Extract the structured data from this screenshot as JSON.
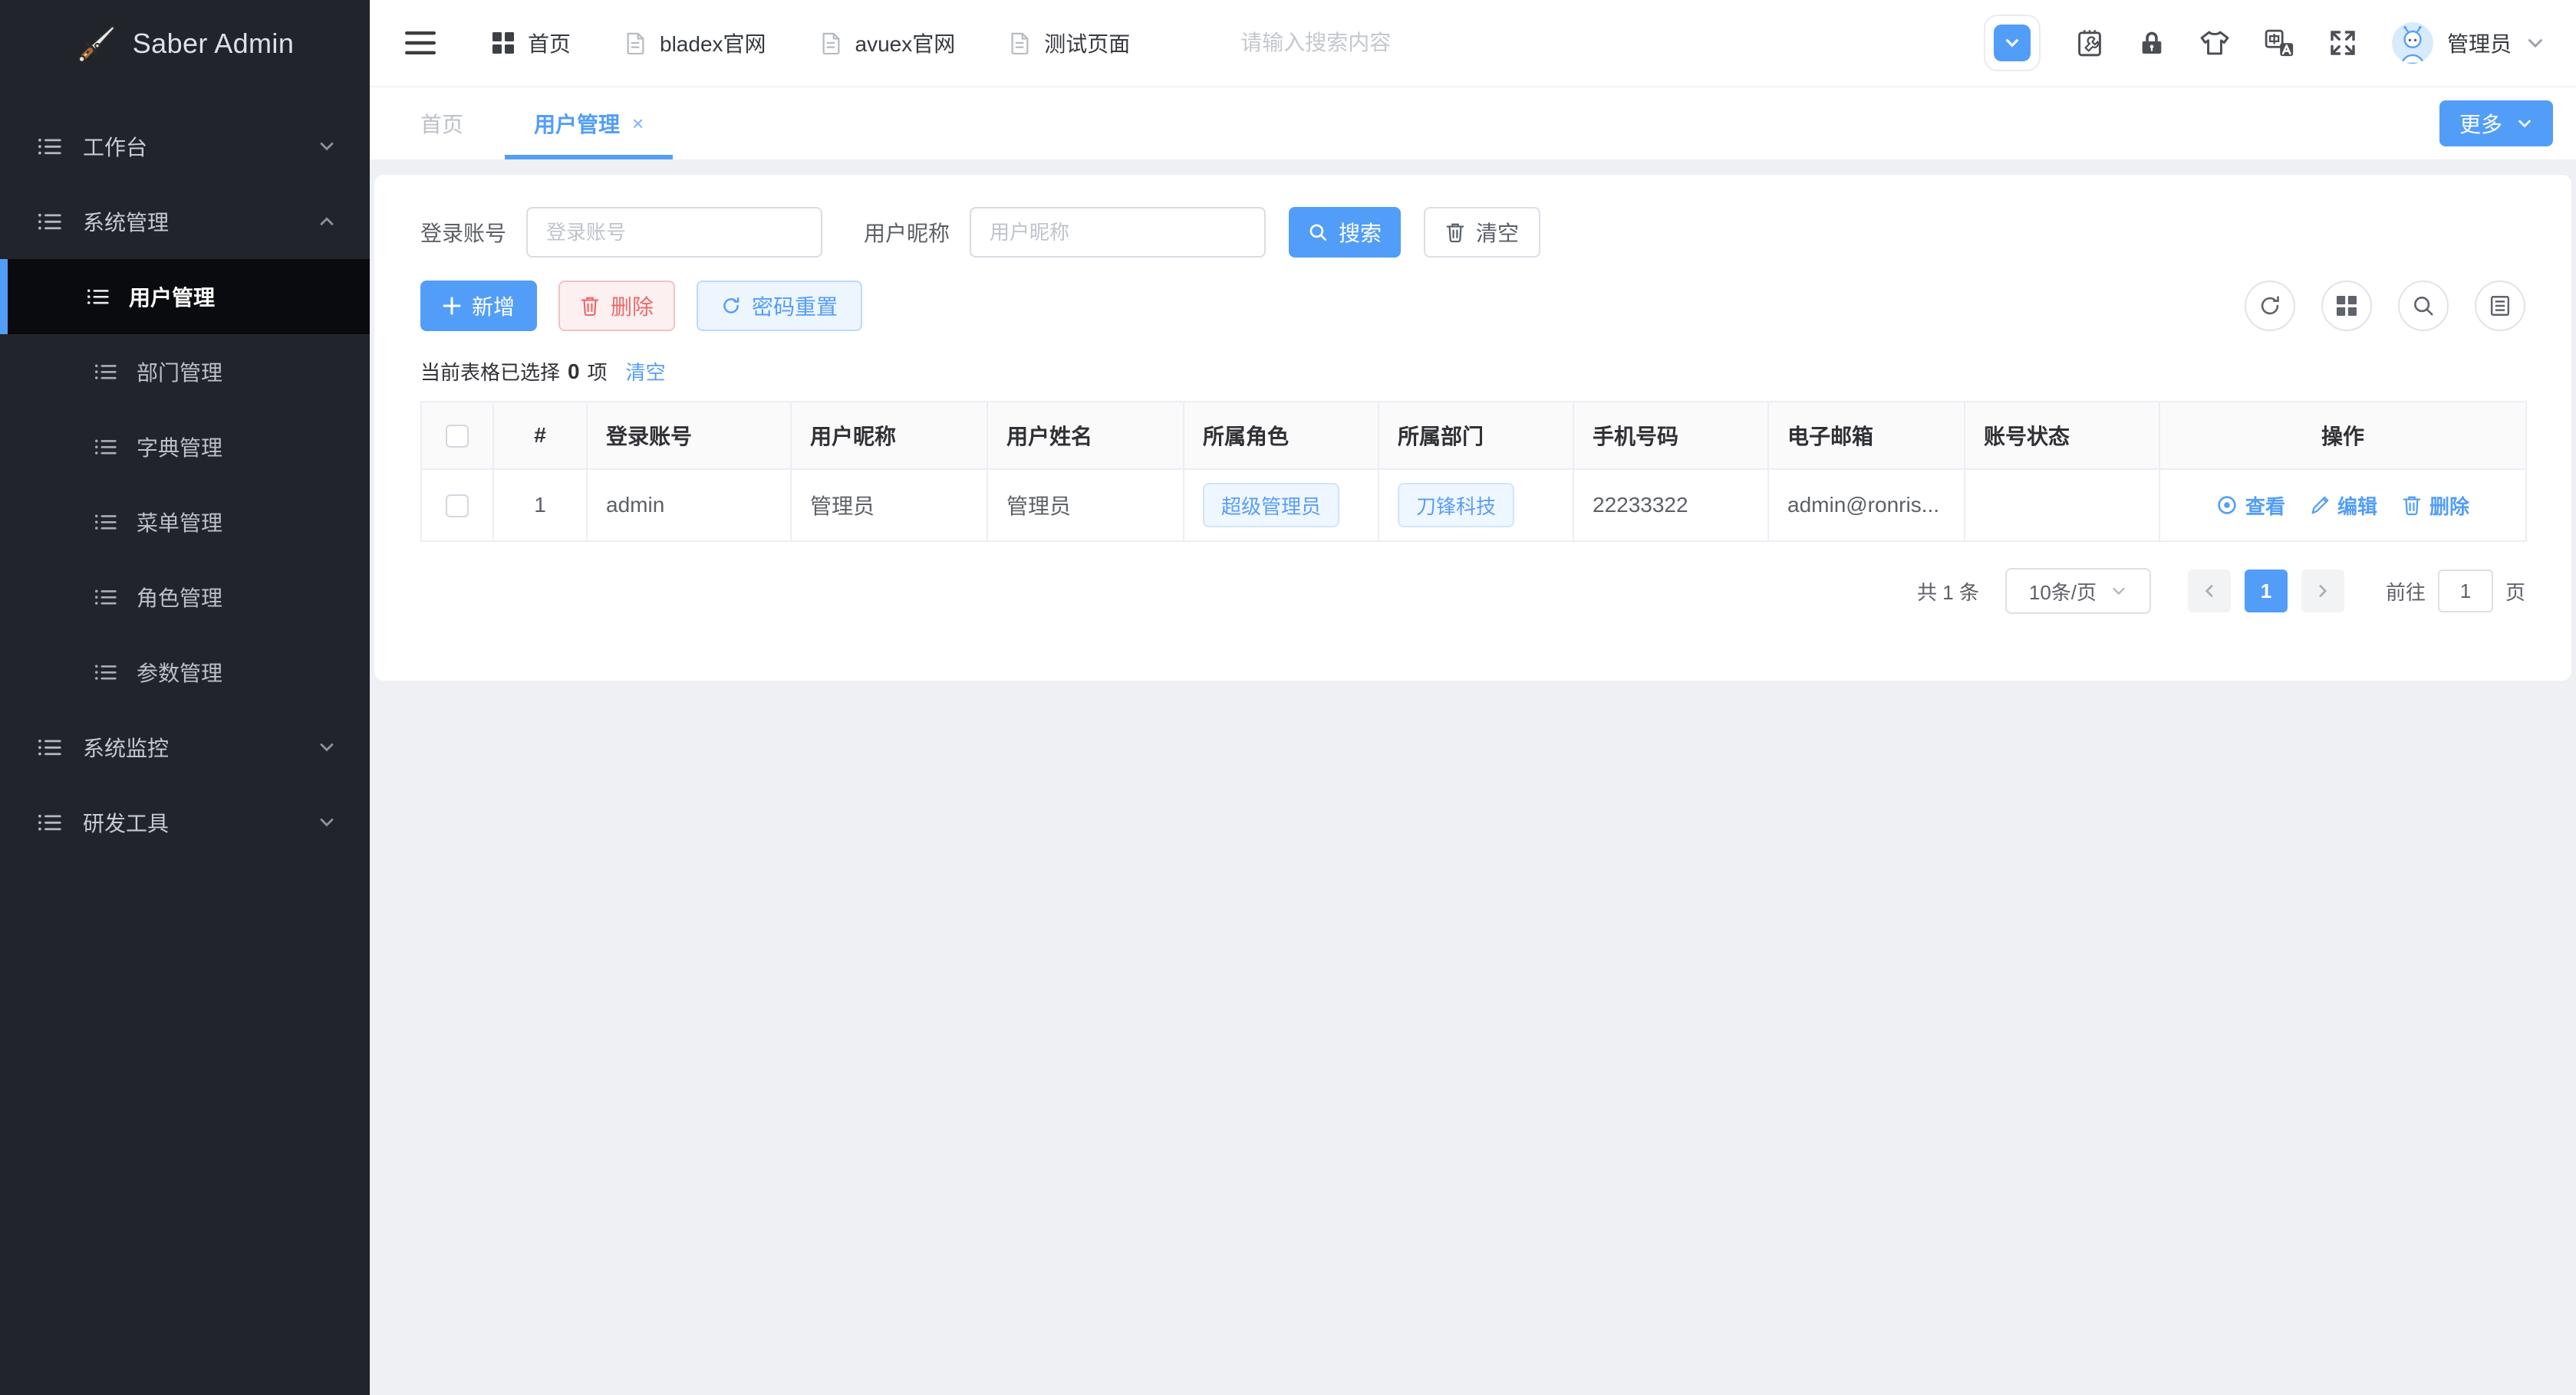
{
  "colors": {
    "accent": "#529df8",
    "danger": "#ec6a6a",
    "sidebar_bg": "#22242b",
    "sidebar_active_bg": "#0a0b0e",
    "page_bg": "#eef0f4",
    "tag_bg": "#eef6ff"
  },
  "logo": {
    "title": "Saber Admin",
    "icon": "dagger-icon"
  },
  "sidebar": {
    "groups": [
      {
        "label": "工作台",
        "state": "collapsed"
      },
      {
        "label": "系统管理",
        "state": "expanded",
        "children": [
          {
            "label": "用户管理",
            "active": true
          },
          {
            "label": "部门管理",
            "active": false
          },
          {
            "label": "字典管理",
            "active": false
          },
          {
            "label": "菜单管理",
            "active": false
          },
          {
            "label": "角色管理",
            "active": false
          },
          {
            "label": "参数管理",
            "active": false
          }
        ]
      },
      {
        "label": "系统监控",
        "state": "collapsed"
      },
      {
        "label": "研发工具",
        "state": "collapsed"
      }
    ]
  },
  "topbar": {
    "menu_items": [
      {
        "label": "首页",
        "icon": "grid-icon"
      },
      {
        "label": "bladex官网",
        "icon": "document-icon"
      },
      {
        "label": "avuex官网",
        "icon": "document-icon"
      },
      {
        "label": "测试页面",
        "icon": "document-icon"
      }
    ],
    "search_placeholder": "请输入搜索内容",
    "right_icons": [
      "top-menu-toggle",
      "debug-icon",
      "lock-icon",
      "theme-icon",
      "language-icon",
      "fullscreen-icon"
    ],
    "user": {
      "name": "管理员"
    }
  },
  "tabs": {
    "items": [
      {
        "label": "首页",
        "active": false
      },
      {
        "label": "用户管理",
        "active": true,
        "close": "×"
      }
    ],
    "more_label": "更多"
  },
  "filters": {
    "fields": [
      {
        "label": "登录账号",
        "placeholder": "登录账号",
        "value": ""
      },
      {
        "label": "用户昵称",
        "placeholder": "用户昵称",
        "value": ""
      }
    ],
    "search_label": "搜索",
    "clear_label": "清空"
  },
  "toolbar": {
    "add_label": "新增",
    "delete_label": "删除",
    "reset_pwd_label": "密码重置",
    "circle_icons": [
      "refresh-icon",
      "grid-icon",
      "search-icon",
      "list-icon"
    ]
  },
  "selection": {
    "prefix": "当前表格已选择",
    "count": "0",
    "suffix": "项",
    "clear_label": "清空"
  },
  "table": {
    "columns": [
      "#",
      "登录账号",
      "用户昵称",
      "用户姓名",
      "所属角色",
      "所属部门",
      "手机号码",
      "电子邮箱",
      "账号状态",
      "操作"
    ],
    "rows": [
      {
        "index": "1",
        "account": "admin",
        "nickname": "管理员",
        "realname": "管理员",
        "role": "超级管理员",
        "dept": "刀锋科技",
        "phone": "22233322",
        "email": "admin@ronris...",
        "status": "",
        "actions": {
          "view": "查看",
          "edit": "编辑",
          "delete": "删除"
        }
      }
    ]
  },
  "pagination": {
    "total": "共 1 条",
    "page_size": "10条/页",
    "current_page": "1",
    "goto_prefix": "前往",
    "goto_value": "1",
    "goto_suffix": "页"
  }
}
